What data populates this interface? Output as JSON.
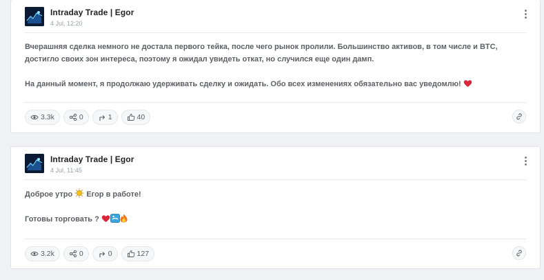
{
  "posts": [
    {
      "author": "Intraday Trade | Egor",
      "time": "4 Jul, 12:20",
      "paragraphs": [
        "Вчерашняя сделка немного не достала первого тейка, после чего рынок пролили. Большинство активов, в том числе и BTC, достигло своих зон интереса, поэтому я ожидал увидеть откат, но случился еще один дамп.",
        "На данный момент, я продолжаю удерживать сделку и ожидать. Обо всех изменениях обязательно вас уведомлю!"
      ],
      "stats": {
        "views": "3.3k",
        "shares": "0",
        "forwards": "1",
        "likes": "40"
      }
    },
    {
      "author": "Intraday Trade | Egor",
      "time": "4 Jul, 11:45",
      "paragraphs": [
        "Доброе утро",
        "Егор в работе!",
        "Готовы торговать ?"
      ],
      "stats": {
        "views": "3.2k",
        "shares": "0",
        "forwards": "0",
        "likes": "127"
      }
    }
  ],
  "icons": {
    "views": "eye-icon",
    "shares": "share-icon",
    "forwards": "forward-icon",
    "likes": "thumbs-up-icon",
    "link": "link-icon",
    "menu": "more-vertical-icon"
  },
  "colors": {
    "heart": "#d9263a",
    "sun": "#f5c518",
    "page_bg": "#f0f1f4"
  }
}
